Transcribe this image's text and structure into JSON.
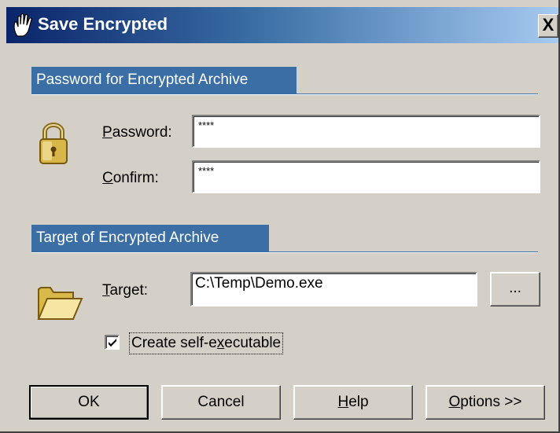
{
  "window": {
    "title": "Save Encrypted",
    "icon": "hand-icon",
    "close_label": "X"
  },
  "password_section": {
    "header": "Password for Encrypted Archive",
    "icon": "padlock-icon",
    "password_label_underlined": "P",
    "password_label_rest": "assword:",
    "password_value": "****",
    "confirm_label_underlined": "C",
    "confirm_label_rest": "onfirm:",
    "confirm_value": "****"
  },
  "target_section": {
    "header": "Target of Encrypted Archive",
    "icon": "folder-icon",
    "target_label_underlined": "T",
    "target_label_rest": "arget:",
    "target_value": "C:\\Temp\\Demo.exe",
    "browse_label": "...",
    "self_extract_checked": true,
    "self_extract_label_pre": "Create self-e",
    "self_extract_label_underlined": "x",
    "self_extract_label_post": "ecutable"
  },
  "buttons": {
    "ok": "OK",
    "cancel": "Cancel",
    "help_underlined": "H",
    "help_rest": "elp",
    "options_underlined": "O",
    "options_rest": "ptions >>"
  },
  "colors": {
    "title_start": "#0a246a",
    "title_end": "#a6caf0",
    "section_header": "#3a6ea5",
    "dialog_bg": "#d4d0c8"
  }
}
